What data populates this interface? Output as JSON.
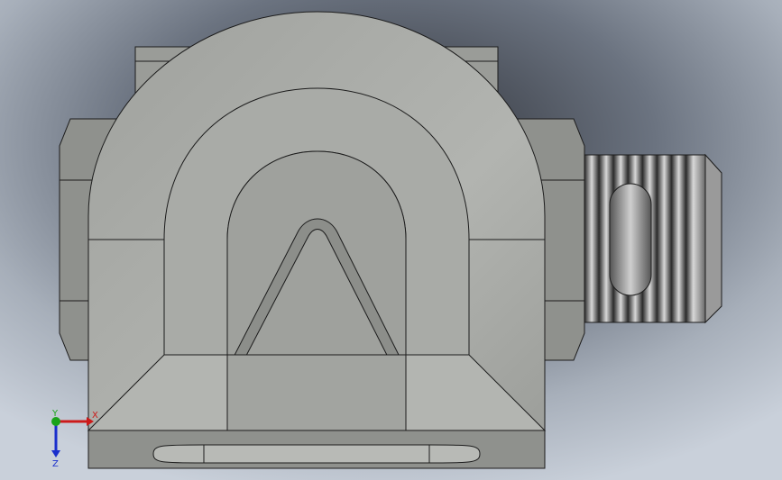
{
  "viewport": {
    "background": {
      "top": "#2e3138",
      "mid": "#9ea6b1",
      "bottom": "#c9d0da"
    }
  },
  "model": {
    "body_color": "#a6a8a4",
    "body_dark": "#8f918d",
    "edge_color": "#1c1c1c",
    "thread_light": "#d8d8d8",
    "thread_dark": "#2a2a2a"
  },
  "triad": {
    "x_label": "X",
    "y_label": "Y",
    "z_label": "Z",
    "x_color": "#cc1a1a",
    "y_color": "#1aa31a",
    "z_color": "#1a2fcc"
  }
}
